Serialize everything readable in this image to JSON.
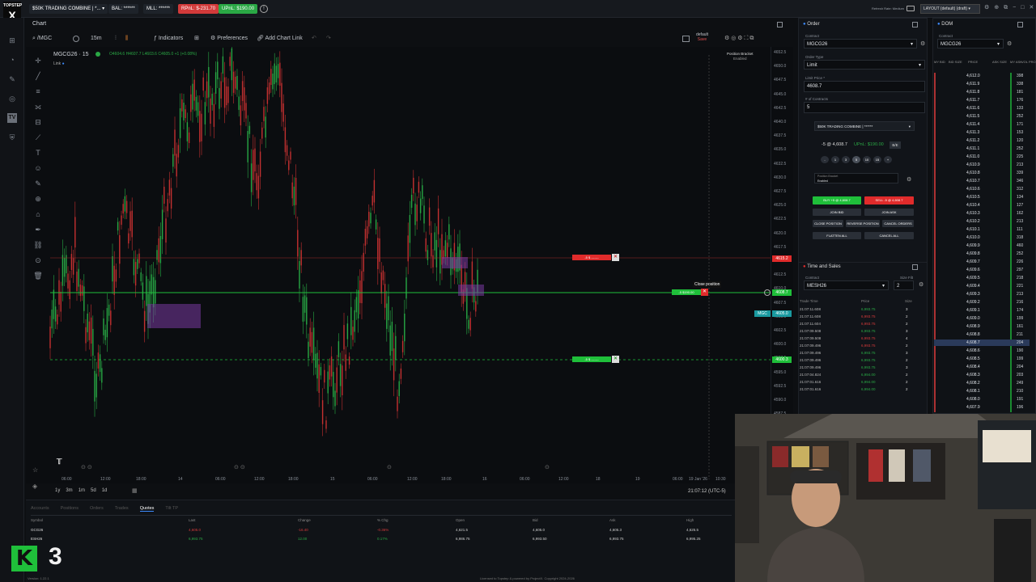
{
  "brand": {
    "name": "TOPSTEP",
    "logo_letter": "X"
  },
  "topbar": {
    "account": "$50K TRADING COMBINE | *...",
    "bal": "BAL: ******",
    "mll": "MLL: ******",
    "rpnl": "RPnL: $-231.70",
    "upnl": "UPnL: $190.00",
    "refresh": "Refresh Rate: Medium",
    "layout": "LAYOUT (default) (draft)"
  },
  "tabs": {
    "chart": "Chart",
    "order": "Order",
    "dom": "DOM",
    "time_sales": "Time and Sales"
  },
  "toolbar": {
    "symbol": "/MGC",
    "interval": "15m",
    "indicators": "Indicators",
    "preferences": "Preferences",
    "add_chart_link": "Add Chart Link",
    "template": "default",
    "template_sub": "Save"
  },
  "chart": {
    "title": "MGCG26 · 15",
    "ohlc": "O4604.6 H4607.7 L4603.6 C4605.0 +1 (+0.08%)",
    "link": "Link",
    "position_bracket": "Position Bracket",
    "position_bracket_state": "Enabled",
    "close_position_tooltip": "Close position",
    "stop_label": "-5 $ -------",
    "target_label": "-5 $ -------",
    "position_label": "-5 $190.00",
    "price_tags": {
      "stop": "4615.2",
      "position": "4608.7",
      "mgc": "4605.0",
      "target": "4600.3"
    },
    "mgc_tag": "MGC",
    "timeframes": [
      "1y",
      "3m",
      "1m",
      "5d",
      "1d"
    ],
    "clock": "21:07:12 (UTC-5)",
    "x_labels": [
      "06:00",
      "12:00",
      "18:00",
      "14",
      "06:00",
      "12:00",
      "18:00",
      "15",
      "06:00",
      "12:00",
      "18:00",
      "16",
      "06:00",
      "12:00",
      "18",
      "19",
      "06:00",
      "19 Jan '26",
      "10:30"
    ],
    "y_labels": [
      "4652.5",
      "4650.0",
      "4647.5",
      "4645.0",
      "4642.5",
      "4640.0",
      "4637.5",
      "4635.0",
      "4632.5",
      "4630.0",
      "4627.5",
      "4625.0",
      "4622.5",
      "4620.0",
      "4617.5",
      "4615.0",
      "4612.5",
      "4610.0",
      "4607.5",
      "4605.0",
      "4602.5",
      "4600.0",
      "4597.5",
      "4595.0",
      "4592.5",
      "4590.0",
      "4587.5"
    ]
  },
  "order": {
    "contract_label": "Contract",
    "contract": "MGCG26",
    "order_type_label": "Order Type",
    "order_type": "Limit",
    "limit_price_label": "Limit Price *",
    "limit_price": "4608.7",
    "contracts_label": "# of Contracts",
    "contracts": "5",
    "account": "$50K TRADING COMBINE | ******",
    "position": "-5 @ 4,608.7",
    "upnl": "UPnL: $190.00",
    "be": "B/E",
    "qty_buttons": [
      "-",
      "1",
      "3",
      "5",
      "10",
      "15",
      "+"
    ],
    "bracket_label": "Position Bracket",
    "bracket_value": "Enabled",
    "buy": "BUY +5 @ 4,608.7",
    "sell": "SELL -5 @ 4,608.7",
    "join_bid": "JOIN BID",
    "join_ask": "JOIN ASK",
    "close_position": "CLOSE POSITION",
    "reverse_position": "REVERSE POSITION",
    "cancel_orders": "CANCEL ORDERS",
    "flatten_all": "FLATTEN ALL",
    "cancel_all": "CANCEL ALL"
  },
  "dom": {
    "contract_label": "Contract",
    "contract": "MGCG26",
    "headers": [
      "MY BID",
      "BID SIZE",
      "PRICE",
      "ASK SIZE",
      "MY ASK",
      "VOL PRO"
    ],
    "prices": [
      "4,612.0",
      "4,611.9",
      "4,611.8",
      "4,611.7",
      "4,611.6",
      "4,611.5",
      "4,611.4",
      "4,611.3",
      "4,611.2",
      "4,611.1",
      "4,611.0",
      "4,610.9",
      "4,610.8",
      "4,610.7",
      "4,610.6",
      "4,610.5",
      "4,610.4",
      "4,610.3",
      "4,610.2",
      "4,610.1",
      "4,610.0",
      "4,609.9",
      "4,609.8",
      "4,609.7",
      "4,609.6",
      "4,609.5",
      "4,609.4",
      "4,609.3",
      "4,609.2",
      "4,609.1",
      "4,609.0",
      "4,608.9",
      "4,608.8",
      "4,608.7",
      "4,608.6",
      "4,608.5",
      "4,608.4",
      "4,608.3",
      "4,608.2",
      "4,608.1",
      "4,608.0",
      "4,607.9"
    ],
    "vols": [
      "398",
      "338",
      "181",
      "176",
      "133",
      "252",
      "171",
      "153",
      "120",
      "252",
      "225",
      "213",
      "339",
      "346",
      "312",
      "134",
      "127",
      "162",
      "213",
      "111",
      "318",
      "460",
      "252",
      "226",
      "297",
      "218",
      "221",
      "213",
      "216",
      "174",
      "199",
      "161",
      "211",
      "204",
      "190",
      "199",
      "204",
      "203",
      "249",
      "210",
      "191",
      "196"
    ]
  },
  "tas": {
    "contract_label": "Contract",
    "contract": "MESH26",
    "size_filter_label": "Size Filt",
    "size_filter": "2",
    "headers": [
      "Trade Time",
      "Price",
      "Size"
    ],
    "rows": [
      {
        "time": "21:07:11.608",
        "price": "6,993.75",
        "size": "3",
        "side": "buy"
      },
      {
        "time": "21:07:11.608",
        "price": "6,993.75",
        "size": "2",
        "side": "sell"
      },
      {
        "time": "21:07:11.604",
        "price": "6,993.75",
        "size": "2",
        "side": "sell"
      },
      {
        "time": "21:07:09.508",
        "price": "6,993.75",
        "size": "3",
        "side": "buy"
      },
      {
        "time": "21:07:09.508",
        "price": "6,993.75",
        "size": "4",
        "side": "sell"
      },
      {
        "time": "21:07:09.496",
        "price": "6,993.75",
        "size": "2",
        "side": "sell"
      },
      {
        "time": "21:07:09.496",
        "price": "6,993.75",
        "size": "3",
        "side": "buy"
      },
      {
        "time": "21:07:09.496",
        "price": "6,993.75",
        "size": "2",
        "side": "buy"
      },
      {
        "time": "21:07:09.496",
        "price": "6,993.75",
        "size": "3",
        "side": "buy"
      },
      {
        "time": "21:07:04.824",
        "price": "6,994.00",
        "size": "2",
        "side": "buy"
      },
      {
        "time": "21:07:01.616",
        "price": "6,994.00",
        "size": "2",
        "side": "buy"
      },
      {
        "time": "21:07:01.616",
        "price": "6,994.00",
        "size": "2",
        "side": "buy"
      }
    ]
  },
  "bottom": {
    "tabs": [
      "Accounts",
      "Positions",
      "Orders",
      "Trades",
      "Quotes",
      "Tilt TP"
    ],
    "active_tab": "Quotes",
    "headers": [
      "Symbol",
      "Last",
      "Change",
      "% Chg",
      "Open",
      "Bid",
      "Ask",
      "High"
    ],
    "rows": [
      {
        "symbol": "GCG26",
        "last": "4,605.0",
        "change": "-16.40",
        "pct": "-0.36%",
        "open": "4,621.5",
        "bid": "4,605.0",
        "ask": "4,605.3",
        "high": "4,625.5"
      },
      {
        "symbol": "ESH26",
        "last": "6,993.75",
        "change": "12.00",
        "pct": "0.17%",
        "open": "6,986.75",
        "bid": "6,993.50",
        "ask": "6,993.75",
        "high": "6,995.25"
      }
    ],
    "footer": "Licensed to Topstep & powered by ProjectX. Copyright 2024-2026",
    "version": "Version: 1.22.1"
  },
  "overlay": {
    "k3": "3"
  },
  "colors": {
    "green": "#1fbf3a",
    "red": "#e02b2b",
    "accent": "#3d8bfd",
    "purple": "#7a3aa0"
  }
}
